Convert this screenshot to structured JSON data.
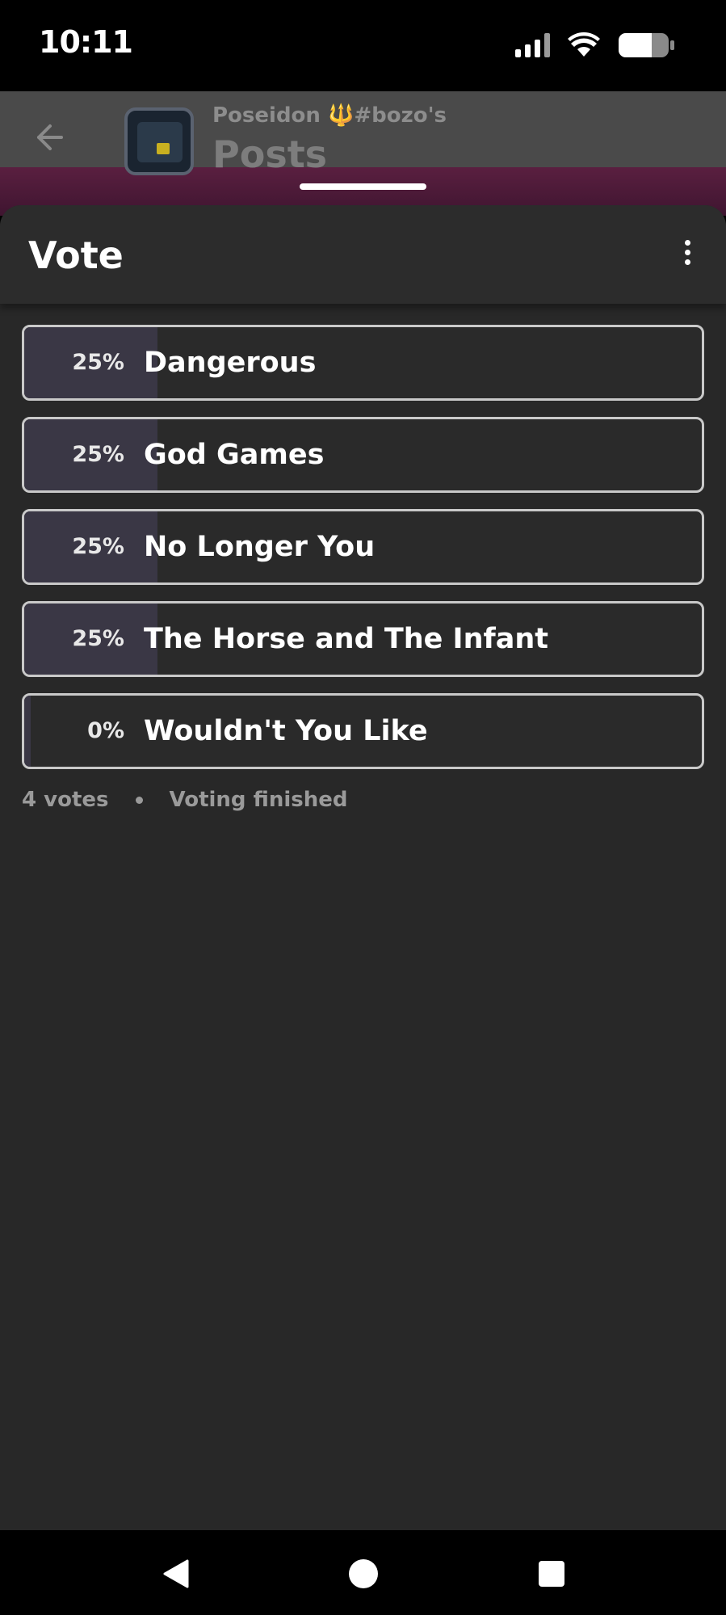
{
  "status_bar": {
    "time": "10:11",
    "signal_icon": "signal-icon",
    "wifi_icon": "wifi-icon",
    "battery_icon": "battery-icon",
    "battery_level": 0.6
  },
  "background": {
    "subtitle": "Poseidon 🔱#bozo's",
    "title": "Posts"
  },
  "sheet": {
    "title": "Vote",
    "menu_icon": "more-vertical-icon"
  },
  "poll": {
    "options": [
      {
        "percent_label": "25%",
        "label": "Dangerous",
        "fraction": 0.25
      },
      {
        "percent_label": "25%",
        "label": "God Games",
        "fraction": 0.25
      },
      {
        "percent_label": "25%",
        "label": "No Longer You",
        "fraction": 0.25
      },
      {
        "percent_label": "25%",
        "label": "The Horse and The Infant",
        "fraction": 0.25
      },
      {
        "percent_label": "0%",
        "label": "Wouldn't You Like",
        "fraction": 0.0
      }
    ],
    "votes_text": "4 votes",
    "status_text": "Voting finished"
  },
  "colors": {
    "sheet_bg": "#282828",
    "fill": "#3a3745",
    "border": "#c9c9c9"
  }
}
